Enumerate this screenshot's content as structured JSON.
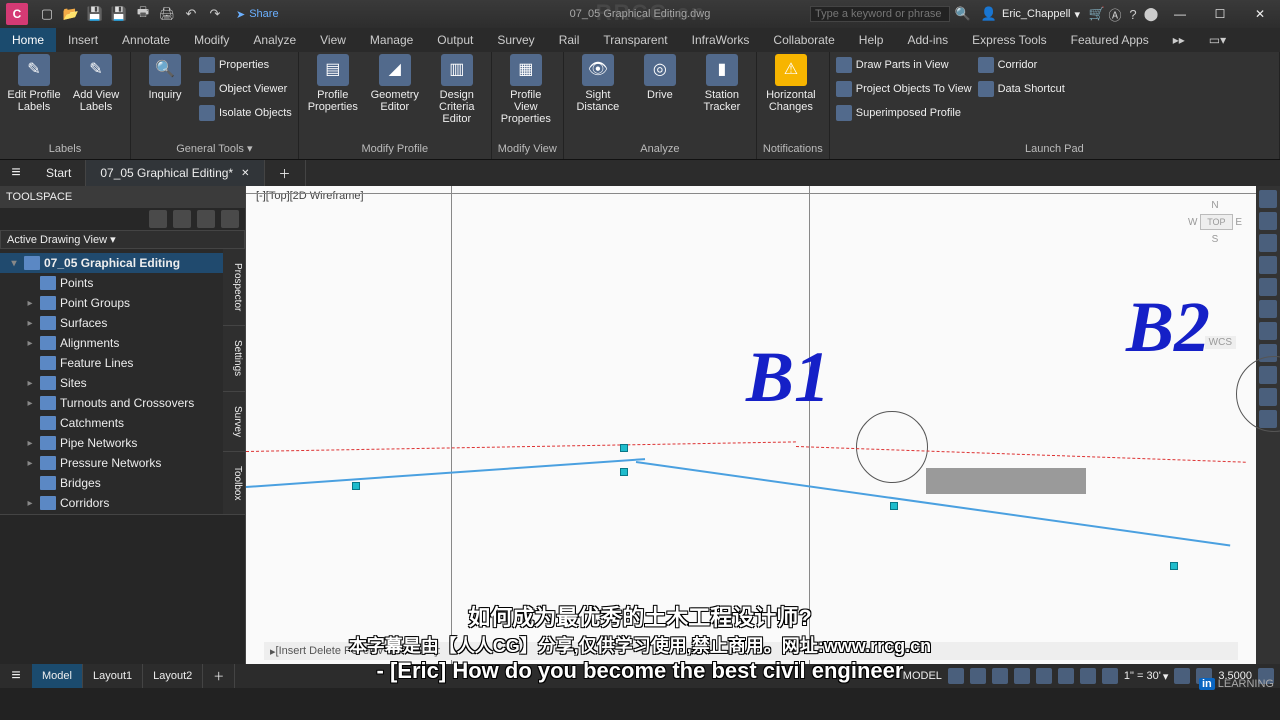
{
  "title_bar": {
    "doc": "07_05 Graphical Editing.dwg",
    "share": "Share",
    "search_placeholder": "Type a keyword or phrase",
    "user": "Eric_Chappell"
  },
  "menu_tabs": [
    "Home",
    "Insert",
    "Annotate",
    "Modify",
    "Analyze",
    "View",
    "Manage",
    "Output",
    "Survey",
    "Rail",
    "Transparent",
    "InfraWorks",
    "Collaborate",
    "Help",
    "Add-ins",
    "Express Tools",
    "Featured Apps"
  ],
  "ribbon": {
    "panels": [
      {
        "title": "Labels",
        "big": [
          {
            "l1": "Edit Profile",
            "l2": "Labels"
          },
          {
            "l1": "Add View",
            "l2": "Labels"
          }
        ],
        "small": []
      },
      {
        "title": "General Tools ▾",
        "big": [
          {
            "l1": "Inquiry",
            "l2": ""
          }
        ],
        "small": [
          "Properties",
          "Object Viewer",
          "Isolate Objects"
        ]
      },
      {
        "title": "Modify Profile",
        "big": [
          {
            "l1": "Profile",
            "l2": "Properties"
          },
          {
            "l1": "Geometry",
            "l2": "Editor"
          },
          {
            "l1": "Design Criteria",
            "l2": "Editor"
          }
        ],
        "small": []
      },
      {
        "title": "Modify View",
        "big": [
          {
            "l1": "Profile View",
            "l2": "Properties"
          }
        ],
        "small": []
      },
      {
        "title": "Analyze",
        "big": [
          {
            "l1": "Sight Distance",
            "l2": ""
          },
          {
            "l1": "Drive",
            "l2": ""
          },
          {
            "l1": "Station",
            "l2": "Tracker"
          }
        ],
        "small": []
      },
      {
        "title": "Notifications",
        "big": [
          {
            "l1": "Horizontal",
            "l2": "Changes"
          }
        ],
        "small": []
      },
      {
        "title": "Launch Pad",
        "big": [],
        "small": [
          "Draw Parts in View",
          "Project Objects To View",
          "Superimposed Profile"
        ],
        "small2": [
          "Corridor",
          "Data Shortcut"
        ]
      }
    ]
  },
  "doc_tabs": {
    "start": "Start",
    "active": "07_05 Graphical Editing*"
  },
  "toolspace": {
    "header": "TOOLSPACE",
    "view_label": "Active Drawing View",
    "root": "07_05 Graphical Editing",
    "nodes": [
      "Points",
      "Point Groups",
      "Surfaces",
      "Alignments",
      "Feature Lines",
      "Sites",
      "Turnouts and Crossovers",
      "Catchments",
      "Pipe Networks",
      "Pressure Networks",
      "Bridges",
      "Corridors"
    ],
    "side_tabs": [
      "Prospector",
      "Settings",
      "Survey",
      "Toolbox"
    ]
  },
  "viewport": {
    "label": "[-][Top][2D Wireframe]",
    "compass": {
      "n": "N",
      "s": "S",
      "e": "E",
      "w": "W",
      "top": "TOP",
      "wcs": "WCS"
    },
    "annot": {
      "b1": "B1",
      "b2": "B2"
    },
    "cmd_prompt": "[Insert Delete FG-elev Undo eXit]:"
  },
  "statusbar": {
    "tabs": [
      "Model",
      "Layout1",
      "Layout2"
    ],
    "scale": "1\" = 30'",
    "zoom": "3.5000",
    "mode": "MODEL"
  },
  "overlay": {
    "line1": "如何成为最优秀的土木工程设计师?",
    "line2": "本字幕是由【人人CG】分享,仅供学习使用,禁止商用。网址:www.rrcg.cn",
    "line3": "- [Eric] How do you become the best civil engineer",
    "watermark": "RRCG.cn",
    "li": "LEARNING"
  }
}
